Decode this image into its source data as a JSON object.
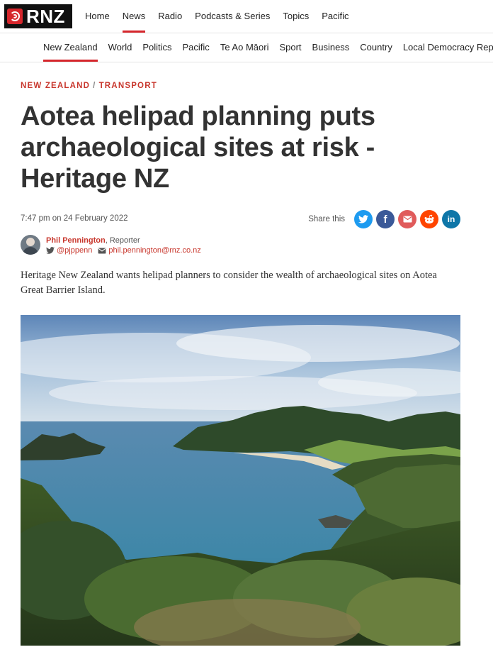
{
  "brand": {
    "logo_text": "RNZ"
  },
  "main_nav": {
    "items": [
      {
        "label": "Home",
        "active": false
      },
      {
        "label": "News",
        "active": true
      },
      {
        "label": "Radio",
        "active": false
      },
      {
        "label": "Podcasts & Series",
        "active": false
      },
      {
        "label": "Topics",
        "active": false
      },
      {
        "label": "Pacific",
        "active": false
      }
    ]
  },
  "sub_nav": {
    "items": [
      {
        "label": "New Zealand",
        "active": true
      },
      {
        "label": "World",
        "active": false
      },
      {
        "label": "Politics",
        "active": false
      },
      {
        "label": "Pacific",
        "active": false
      },
      {
        "label": "Te Ao Māori",
        "active": false
      },
      {
        "label": "Sport",
        "active": false
      },
      {
        "label": "Business",
        "active": false
      },
      {
        "label": "Country",
        "active": false
      },
      {
        "label": "Local Democracy Reporting",
        "active": false
      }
    ]
  },
  "article": {
    "breadcrumb": {
      "section": "NEW ZEALAND",
      "separator": "/",
      "topic": "TRANSPORT"
    },
    "headline": "Aotea helipad planning puts archaeological sites at risk - Heritage NZ",
    "date": "7:47 pm on 24 February 2022",
    "share": {
      "label": "Share this",
      "buttons": [
        {
          "name": "twitter",
          "icon": "twitter-icon",
          "color": "#1d9bf0"
        },
        {
          "name": "facebook",
          "icon": "facebook-icon",
          "color": "#3b5998"
        },
        {
          "name": "email",
          "icon": "email-icon",
          "color": "#e05b5b"
        },
        {
          "name": "reddit",
          "icon": "reddit-icon",
          "color": "#ff4500"
        },
        {
          "name": "linkedin",
          "icon": "linkedin-icon",
          "color": "#0e76a8"
        }
      ]
    },
    "author": {
      "name": "Phil Pennington",
      "role": ", Reporter",
      "twitter": "@pjppenn",
      "email": "phil.pennington@rnz.co.nz"
    },
    "lead": "Heritage New Zealand wants helipad planners to consider the wealth of archaeological sites on Aotea Great Barrier Island."
  },
  "colors": {
    "accent": "#d6262c",
    "link": "#c8372d",
    "text": "#333333"
  }
}
